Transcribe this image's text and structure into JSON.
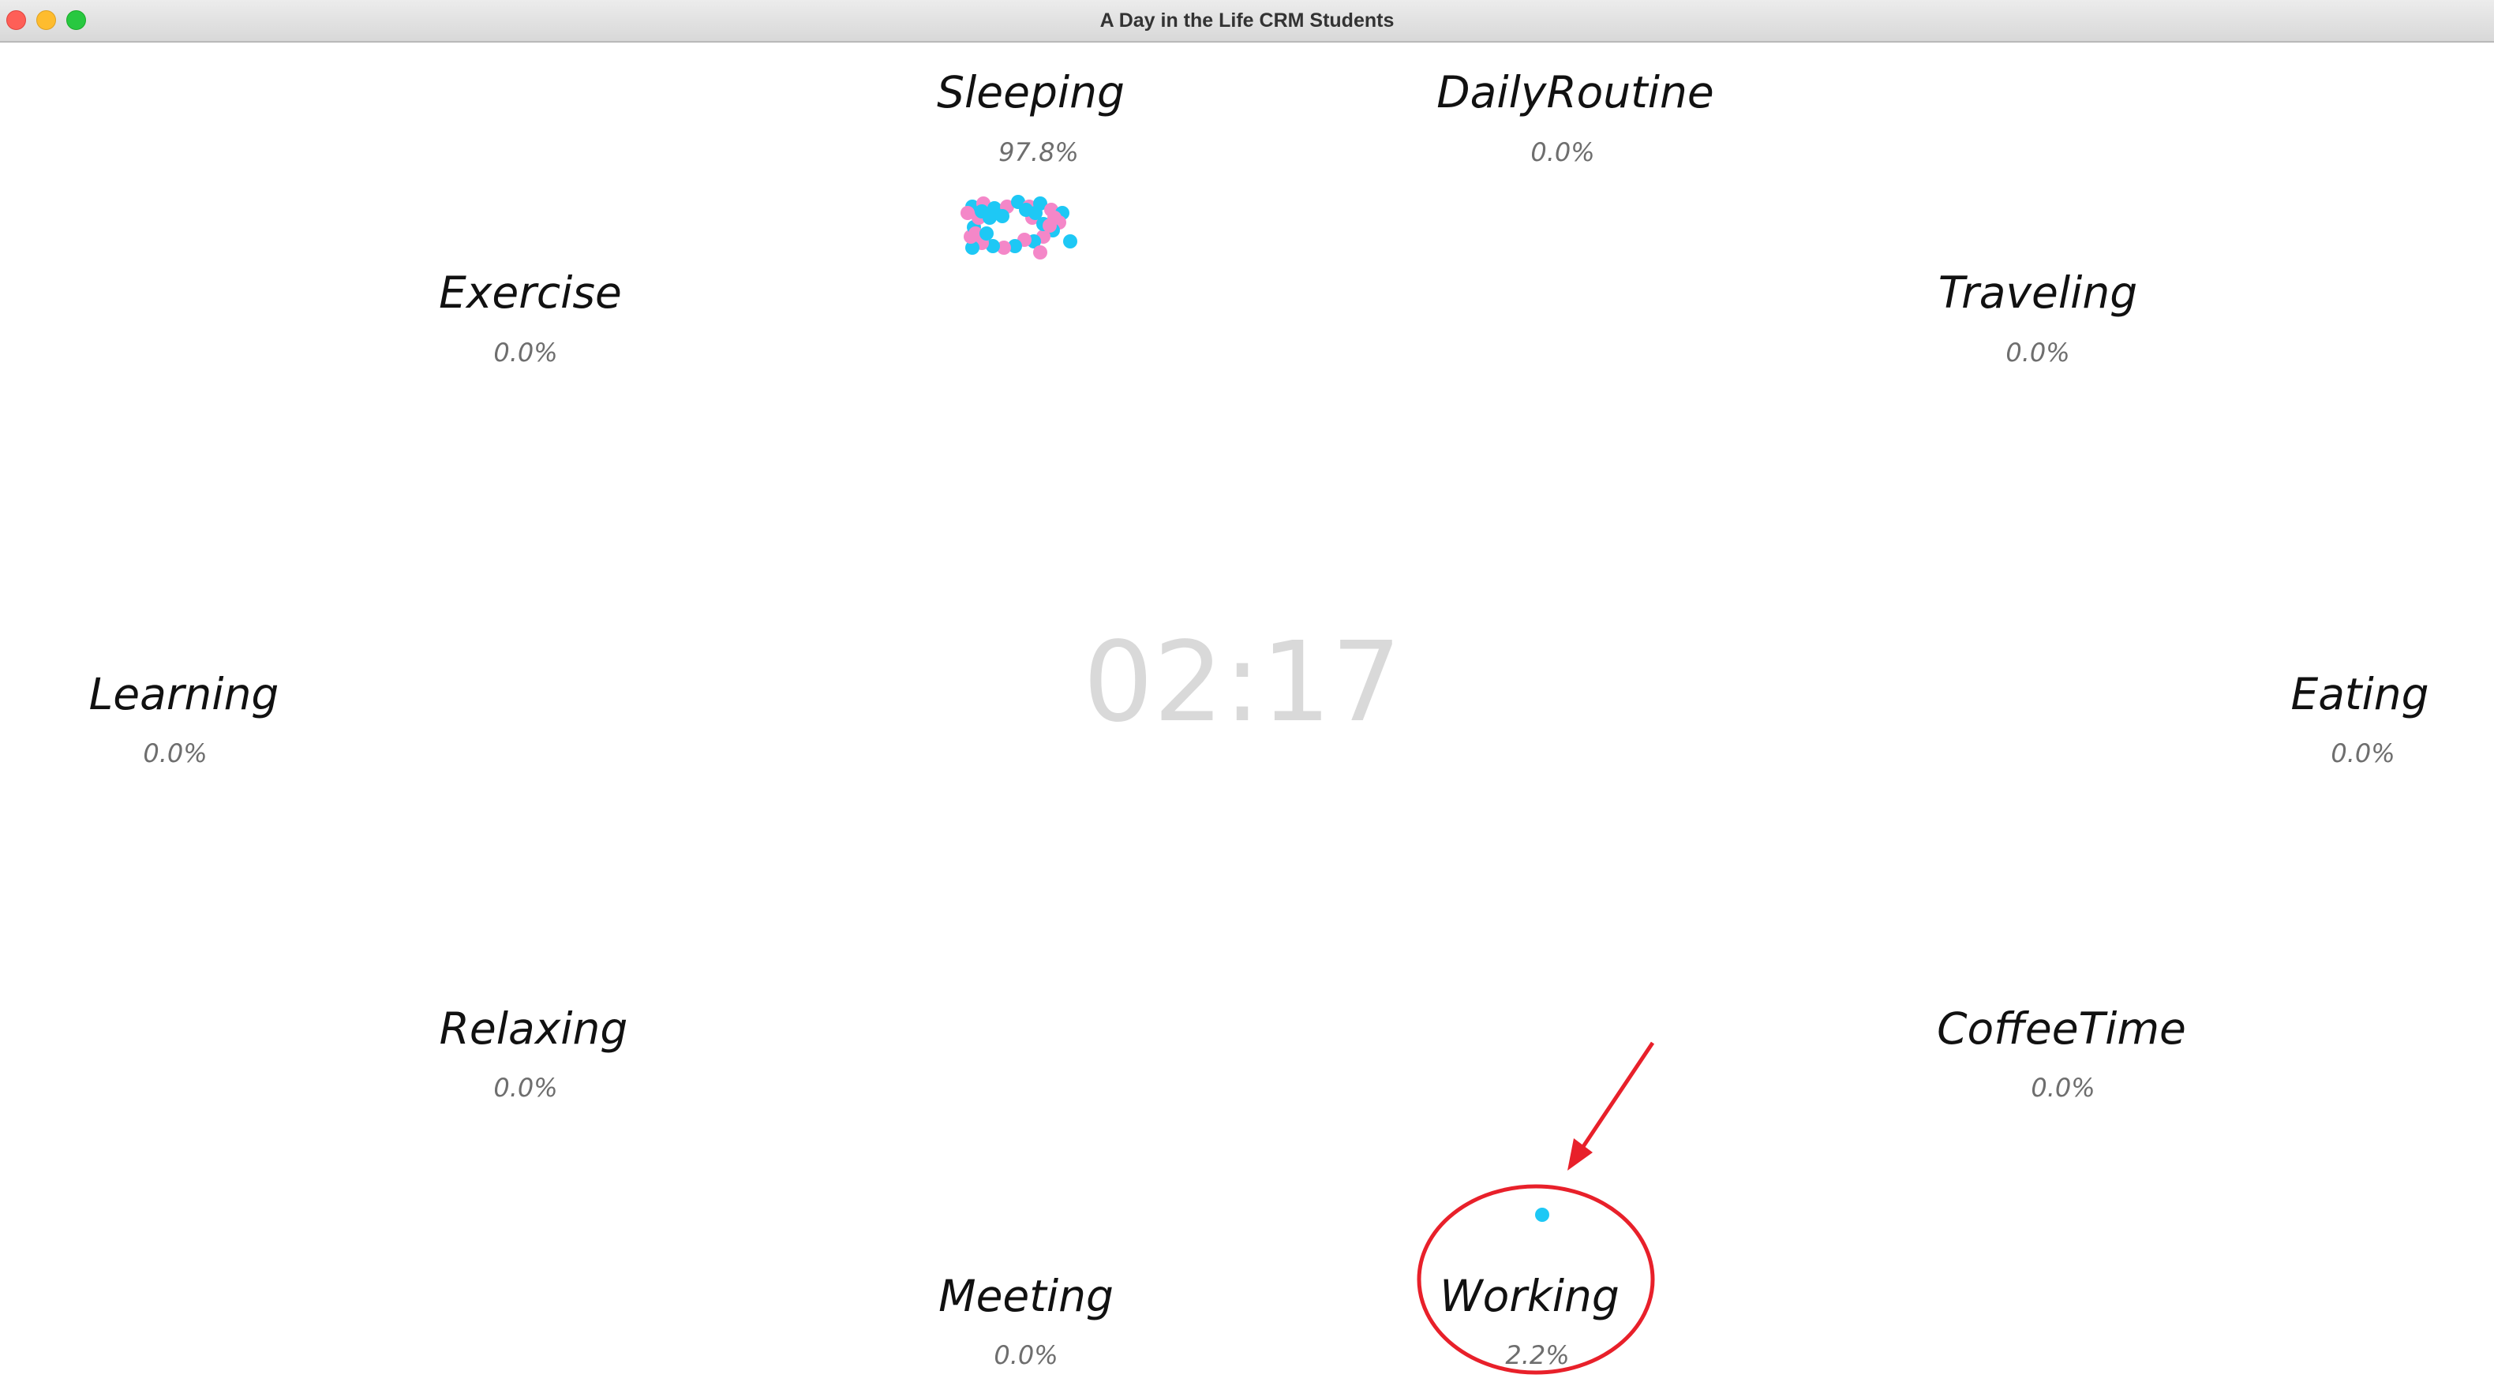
{
  "window": {
    "title": "A Day in the Life CRM Students"
  },
  "clock": {
    "time": "02:17"
  },
  "activities": {
    "sleeping": {
      "label": "Sleeping",
      "percent": "97.8%"
    },
    "daily_routine": {
      "label": "DailyRoutine",
      "percent": "0.0%"
    },
    "exercise": {
      "label": "Exercise",
      "percent": "0.0%"
    },
    "traveling": {
      "label": "Traveling",
      "percent": "0.0%"
    },
    "learning": {
      "label": "Learning",
      "percent": "0.0%"
    },
    "eating": {
      "label": "Eating",
      "percent": "0.0%"
    },
    "relaxing": {
      "label": "Relaxing",
      "percent": "0.0%"
    },
    "coffee_time": {
      "label": "CoffeeTime",
      "percent": "0.0%"
    },
    "meeting": {
      "label": "Meeting",
      "percent": "0.0%"
    },
    "working": {
      "label": "Working",
      "percent": "2.2%"
    }
  },
  "colors": {
    "dot_blue": "#1ec8f5",
    "dot_pink": "#f487c8",
    "annotation_red": "#e8202a",
    "clock_gray": "#d9d9d9"
  }
}
